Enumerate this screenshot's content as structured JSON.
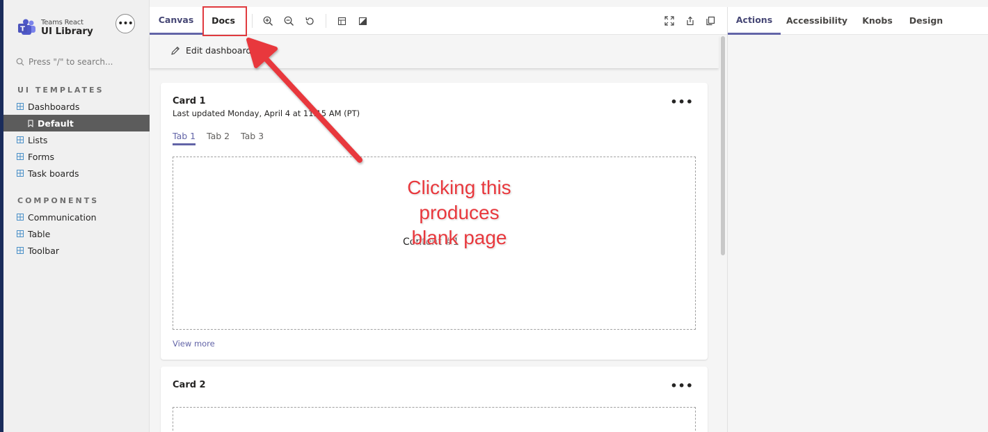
{
  "brand": {
    "sub": "Teams React",
    "main": "UI Library"
  },
  "sidebar": {
    "search_placeholder": "Press \"/\" to search...",
    "section_templates": "UI TEMPLATES",
    "section_components": "COMPONENTS",
    "templates": [
      {
        "label": "Dashboards"
      },
      {
        "label": "Default",
        "active": true
      },
      {
        "label": "Lists"
      },
      {
        "label": "Forms"
      },
      {
        "label": "Task boards"
      }
    ],
    "components": [
      {
        "label": "Communication"
      },
      {
        "label": "Table"
      },
      {
        "label": "Toolbar"
      }
    ]
  },
  "center": {
    "tabs": {
      "canvas": "Canvas",
      "docs": "Docs"
    },
    "edit_label": "Edit dashboard",
    "cards": [
      {
        "title": "Card 1",
        "subtitle": "Last updated Monday, April 4 at 11:15 AM (PT)",
        "tabs": [
          "Tab 1",
          "Tab 2",
          "Tab 3"
        ],
        "content": "Content #1",
        "view_more": "View more"
      },
      {
        "title": "Card 2"
      }
    ]
  },
  "right_panel": {
    "tabs": [
      "Actions",
      "Accessibility",
      "Knobs",
      "Design"
    ]
  },
  "annotation": {
    "lines": [
      "Clicking this",
      "produces",
      "blank page"
    ]
  },
  "colors": {
    "accent": "#6264a7",
    "annotation": "#e8383d",
    "active_nav": "#5c5c5c"
  }
}
